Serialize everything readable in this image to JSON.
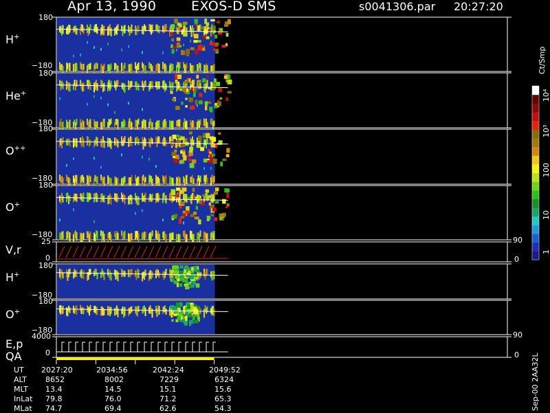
{
  "header": {
    "date": "Apr 13, 1990",
    "mission": "EXOS-D SMS",
    "file": "s0041306.par",
    "time": "20:27:20"
  },
  "colorbar": {
    "unit": "Ct/Smp",
    "labels": [
      "1",
      "10",
      "100",
      "10³",
      "10⁴"
    ],
    "colors": [
      "#1a1a8a",
      "#1f2fb0",
      "#1e5fd0",
      "#1f9ad8",
      "#22c9c4",
      "#19a66a",
      "#1b8f2a",
      "#2ebf1a",
      "#6fd21a",
      "#b9e21a",
      "#f3f01a",
      "#f0c81a",
      "#d08a10",
      "#a07a10",
      "#8a6a0a",
      "#e82010",
      "#c01010",
      "#8a0a0a",
      "#600505",
      "#ffffff"
    ]
  },
  "version_label": "Sep-00  2AA32L",
  "panels": [
    {
      "label": "H",
      "sup": "+",
      "top": "180",
      "bottom": "−180"
    },
    {
      "label": "He",
      "sup": "+",
      "top": "180",
      "bottom": "−180"
    },
    {
      "label": "O",
      "sup": "++",
      "top": "180",
      "bottom": "−180"
    },
    {
      "label": "O",
      "sup": "+",
      "top": "180",
      "bottom": "−180"
    },
    {
      "label": "V,r",
      "sup": "",
      "top": "25",
      "bottom": "0",
      "right_top": "90",
      "right_bottom": "0"
    },
    {
      "label": "H",
      "sup": "+",
      "top": "180",
      "bottom": "−180"
    },
    {
      "label": "O",
      "sup": "+",
      "top": "180",
      "bottom": "−180"
    },
    {
      "label": "E,p",
      "sup": "",
      "top": "4000",
      "bottom": "0",
      "right_top": "90",
      "right_bottom": "0"
    }
  ],
  "qa_label": "QA",
  "ephemeris": {
    "rows": [
      {
        "name": "UT",
        "values": [
          "2027:20",
          "2034:56",
          "2042:24",
          "2049:52"
        ]
      },
      {
        "name": "ALT",
        "values": [
          "8652",
          "8002",
          "7229",
          "6324"
        ]
      },
      {
        "name": "MLT",
        "values": [
          "13.4",
          "14.5",
          "15.1",
          "15.6"
        ]
      },
      {
        "name": "InLat",
        "values": [
          "79.8",
          "76.0",
          "71.2",
          "65.3"
        ]
      },
      {
        "name": "MLat",
        "values": [
          "74.7",
          "69.4",
          "62.6",
          "54.3"
        ]
      }
    ]
  },
  "chart_data": {
    "type": "heatmap",
    "title": "Apr 13, 1990   EXOS-D SMS",
    "x_ticks": [
      "2027:20",
      "2034:56",
      "2042:24",
      "2049:52"
    ],
    "data_end_fraction": 0.35,
    "panels": [
      {
        "species": "H+",
        "ylim": [
          -180,
          180
        ]
      },
      {
        "species": "He+",
        "ylim": [
          -180,
          180
        ]
      },
      {
        "species": "O++",
        "ylim": [
          -180,
          180
        ]
      },
      {
        "species": "O+",
        "ylim": [
          -180,
          180
        ]
      },
      {
        "species": "V,r",
        "ylim": [
          0,
          25
        ],
        "right_ylim": [
          0,
          90
        ]
      },
      {
        "species": "H+",
        "ylim": [
          -180,
          180
        ]
      },
      {
        "species": "O+",
        "ylim": [
          -180,
          180
        ]
      },
      {
        "species": "E,p",
        "ylim": [
          0,
          4000
        ],
        "right_ylim": [
          0,
          90
        ]
      }
    ]
  }
}
